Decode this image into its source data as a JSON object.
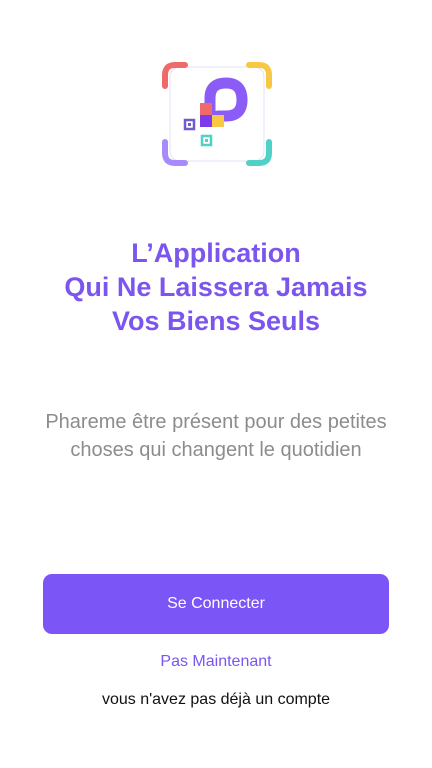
{
  "logo": {
    "icon": "p-qr-logo-icon",
    "colors": {
      "corner_top_left": "#ef6a6a",
      "corner_top_right": "#f7c843",
      "corner_bottom_left": "#a78bfa",
      "corner_bottom_right": "#4fd1c5",
      "letter": "#8b5cf6",
      "block_red": "#ef6a6a",
      "block_yellow": "#f7c843",
      "block_purple": "#7c3aed",
      "qr_purple": "#6d5bd0",
      "qr_teal": "#4fd1c5"
    }
  },
  "headline": {
    "line1": "L’Application",
    "line2": "Qui Ne Laissera Jamais",
    "line3": "Vos Biens Seuls"
  },
  "subtitle": {
    "line1": "Phareme être présent pour des petites",
    "line2": "choses qui changent le quotidien"
  },
  "actions": {
    "connect_label": "Se Connecter",
    "later_label": "Pas Maintenant",
    "no_account_label": "vous n'avez pas déjà un compte"
  },
  "theme": {
    "accent": "#7b55f5",
    "headline_color": "#7b55ee",
    "subtitle_color": "#8c8c8c"
  }
}
